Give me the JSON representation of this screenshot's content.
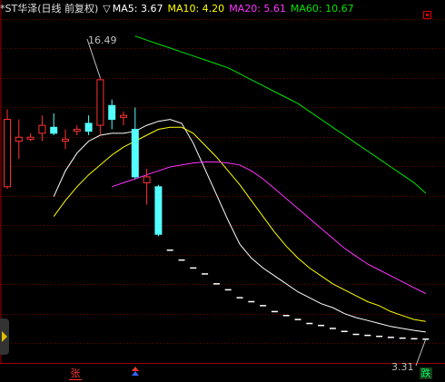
{
  "legend": {
    "title": "*ST华泽(日线 前复权)",
    "ma_marker": "▽",
    "ma5": "MA5: 3.67",
    "ma10": "MA10: 4.20",
    "ma20": "MA20: 5.61",
    "ma60": "MA60: 10.67"
  },
  "colors": {
    "background": "#000000",
    "rise": "#ff3333",
    "fall": "#54ffff",
    "grid": "#7a0000",
    "ma5": "#ffffff",
    "ma10": "#ffff00",
    "ma20": "#ff33ff",
    "ma60": "#00e600"
  },
  "markers": {
    "rise_label": "张",
    "fall_label": "跌",
    "up_arrow_icon": "red-blue-up-arrow-icon"
  },
  "chart_data": {
    "type": "candlestick",
    "title": "*ST华泽(日线 前复权)",
    "ylim": [
      2.2,
      19.6
    ],
    "high_label": "16.49",
    "low_label": "3.31",
    "candles": [
      {
        "open": 11.0,
        "close": 14.4,
        "high": 14.9,
        "low": 10.9
      },
      {
        "open": 13.3,
        "close": 13.5,
        "high": 14.4,
        "low": 12.4
      },
      {
        "open": 13.4,
        "close": 13.5,
        "high": 13.7,
        "low": 13.3
      },
      {
        "open": 13.7,
        "close": 14.1,
        "high": 14.6,
        "low": 13.3
      },
      {
        "open": 14.0,
        "close": 13.7,
        "high": 14.7,
        "low": 13.6
      },
      {
        "open": 13.3,
        "close": 13.4,
        "high": 13.9,
        "low": 12.9
      },
      {
        "open": 13.8,
        "close": 13.9,
        "high": 14.1,
        "low": 13.6
      },
      {
        "open": 14.2,
        "close": 13.8,
        "high": 14.6,
        "low": 13.6
      },
      {
        "open": 14.1,
        "close": 16.4,
        "high": 16.49,
        "low": 13.6
      },
      {
        "open": 15.1,
        "close": 14.4,
        "high": 15.4,
        "low": 13.9
      },
      {
        "open": 14.5,
        "close": 14.6,
        "high": 14.8,
        "low": 14.1
      },
      {
        "open": 13.9,
        "close": 11.5,
        "high": 15.0,
        "low": 11.4
      },
      {
        "open": 11.2,
        "close": 11.5,
        "high": 11.9,
        "low": 10.1
      },
      {
        "open": 11.0,
        "close": 8.6,
        "high": 11.1,
        "low": 8.5
      },
      {
        "open": 7.8,
        "close": 7.8,
        "high": 7.8,
        "low": 7.8
      },
      {
        "open": 7.3,
        "close": 7.3,
        "high": 7.3,
        "low": 7.3
      },
      {
        "open": 6.9,
        "close": 6.9,
        "high": 6.9,
        "low": 6.9
      },
      {
        "open": 6.6,
        "close": 6.6,
        "high": 6.6,
        "low": 6.6
      },
      {
        "open": 6.1,
        "close": 6.1,
        "high": 6.1,
        "low": 6.1
      },
      {
        "open": 5.8,
        "close": 5.8,
        "high": 5.8,
        "low": 5.8
      },
      {
        "open": 5.4,
        "close": 5.4,
        "high": 5.4,
        "low": 5.4
      },
      {
        "open": 5.2,
        "close": 5.2,
        "high": 5.2,
        "low": 5.2
      },
      {
        "open": 5.0,
        "close": 5.0,
        "high": 5.0,
        "low": 5.0
      },
      {
        "open": 4.7,
        "close": 4.7,
        "high": 4.7,
        "low": 4.7
      },
      {
        "open": 4.5,
        "close": 4.5,
        "high": 4.5,
        "low": 4.5
      },
      {
        "open": 4.3,
        "close": 4.3,
        "high": 4.3,
        "low": 4.3
      },
      {
        "open": 4.1,
        "close": 4.1,
        "high": 4.1,
        "low": 4.1
      },
      {
        "open": 4.0,
        "close": 4.0,
        "high": 4.0,
        "low": 4.0
      },
      {
        "open": 3.85,
        "close": 3.85,
        "high": 3.85,
        "low": 3.85
      },
      {
        "open": 3.7,
        "close": 3.7,
        "high": 3.7,
        "low": 3.7
      },
      {
        "open": 3.55,
        "close": 3.55,
        "high": 3.55,
        "low": 3.55
      },
      {
        "open": 3.5,
        "close": 3.5,
        "high": 3.5,
        "low": 3.5
      },
      {
        "open": 3.45,
        "close": 3.45,
        "high": 3.45,
        "low": 3.45
      },
      {
        "open": 3.4,
        "close": 3.4,
        "high": 3.4,
        "low": 3.4
      },
      {
        "open": 3.36,
        "close": 3.36,
        "high": 3.36,
        "low": 3.36
      },
      {
        "open": 3.33,
        "close": 3.33,
        "high": 3.33,
        "low": 3.33
      },
      {
        "open": 3.31,
        "close": 3.31,
        "high": 3.31,
        "low": 3.31
      }
    ],
    "series": [
      {
        "name": "MA5",
        "color": "#ffffff",
        "values": [
          10.5,
          11.8,
          12.7,
          13.3,
          13.6,
          13.7,
          13.7,
          13.8,
          14.1,
          14.3,
          14.4,
          14.2,
          13.2,
          11.9,
          10.6,
          9.3,
          8.1,
          7.4,
          6.9,
          6.5,
          6.1,
          5.7,
          5.4,
          5.1,
          4.9,
          4.6,
          4.4,
          4.25,
          4.1,
          3.95,
          3.85,
          3.75,
          3.67
        ]
      },
      {
        "name": "MA10",
        "color": "#ffff00",
        "values": [
          9.5,
          10.3,
          11.0,
          11.6,
          12.1,
          12.6,
          13.0,
          13.3,
          13.6,
          13.9,
          14.0,
          14.0,
          13.7,
          13.1,
          12.5,
          11.8,
          11.1,
          10.3,
          9.5,
          8.7,
          8.0,
          7.4,
          6.9,
          6.5,
          6.1,
          5.8,
          5.5,
          5.2,
          5.0,
          4.7,
          4.5,
          4.3,
          4.2
        ]
      },
      {
        "name": "MA20",
        "color": "#ff33ff",
        "values": [
          11.0,
          11.2,
          11.4,
          11.6,
          11.8,
          12.0,
          12.1,
          12.2,
          12.25,
          12.25,
          12.2,
          12.1,
          11.8,
          11.4,
          10.9,
          10.4,
          9.9,
          9.4,
          8.9,
          8.4,
          7.9,
          7.5,
          7.1,
          6.8,
          6.5,
          6.2,
          5.9,
          5.61
        ]
      },
      {
        "name": "MA60",
        "color": "#00e600",
        "values": [
          18.6,
          18.4,
          18.2,
          18.0,
          17.8,
          17.6,
          17.4,
          17.2,
          17.0,
          16.7,
          16.4,
          16.1,
          15.8,
          15.5,
          15.2,
          14.8,
          14.4,
          14.0,
          13.6,
          13.2,
          12.8,
          12.4,
          12.0,
          11.6,
          11.2,
          10.67
        ]
      }
    ]
  }
}
